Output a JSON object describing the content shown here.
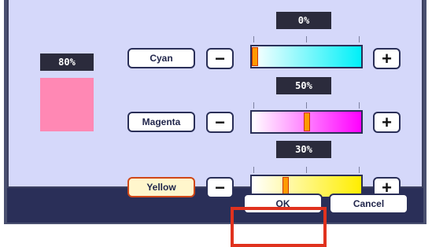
{
  "preview": {
    "density_label": "80%",
    "swatch_color": "#ff88b4"
  },
  "rows": [
    {
      "name": "Cyan",
      "percent_label": "0%",
      "value": 0,
      "gradient": [
        "#ffffff",
        "#00f0f8"
      ]
    },
    {
      "name": "Magenta",
      "percent_label": "50%",
      "value": 50,
      "gradient": [
        "#ffffff",
        "#ff00ff"
      ]
    },
    {
      "name": "Yellow",
      "percent_label": "30%",
      "value": 30,
      "gradient": [
        "#ffffff",
        "#ffee00"
      ],
      "selected": true
    }
  ],
  "controls": {
    "minus_symbol": "−",
    "plus_symbol": "+"
  },
  "footer": {
    "ok_label": "OK",
    "cancel_label": "Cancel"
  }
}
